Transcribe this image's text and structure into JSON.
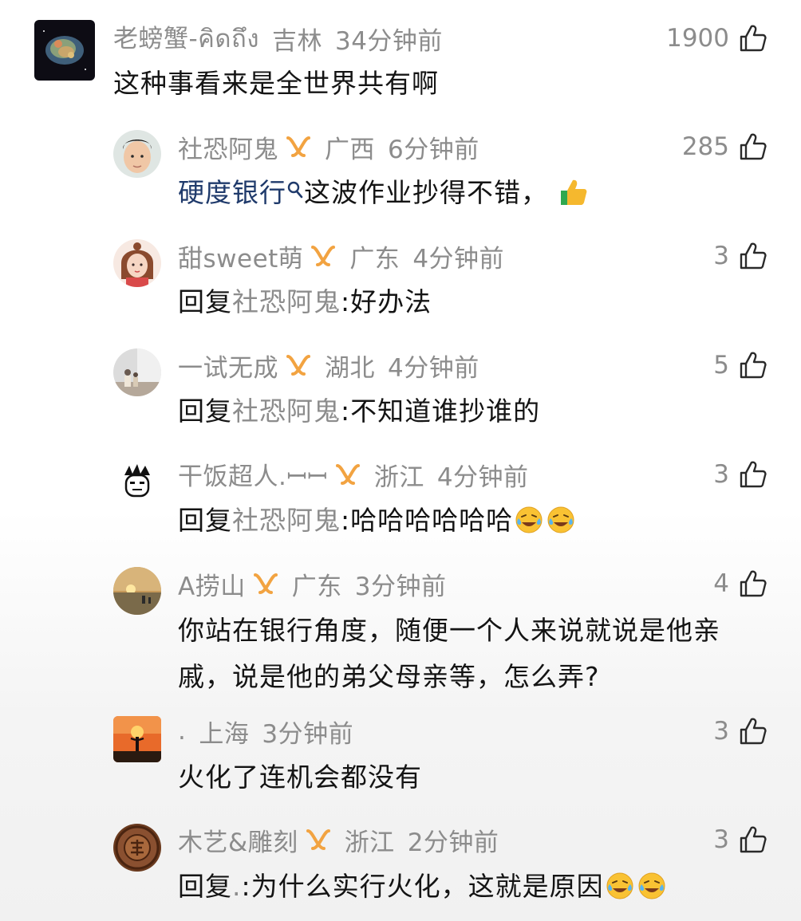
{
  "comments": [
    {
      "username": "老螃蟹-คิดถึง",
      "location": "吉林",
      "time": "34分钟前",
      "likes": "1900",
      "text": "这种事看来是全世界共有啊",
      "avatar_icon": "nebula-avatar"
    },
    {
      "username": "社恐阿鬼",
      "location": "广西",
      "time": "6分钟前",
      "likes": "285",
      "link_text": "硬度银行",
      "text": "这波作业抄得不错，",
      "emoji": "thumbs-up-emoji",
      "avatar_icon": "young-man-avatar"
    },
    {
      "username": "甜sweet萌",
      "location": "广东",
      "time": "4分钟前",
      "likes": "3",
      "reply_prefix": "回复",
      "reply_target": "社恐阿鬼",
      "text": ":好办法",
      "avatar_icon": "cartoon-girl-avatar"
    },
    {
      "username": "一试无成",
      "location": "湖北",
      "time": "4分钟前",
      "likes": "5",
      "reply_prefix": "回复",
      "reply_target": "社恐阿鬼",
      "text": ":不知道谁抄谁的",
      "avatar_icon": "street-photo-avatar"
    },
    {
      "username": "干饭超人.ꟷꟷ",
      "location": "浙江",
      "time": "4分钟前",
      "likes": "3",
      "reply_prefix": "回复",
      "reply_target": "社恐阿鬼",
      "text": ":哈哈哈哈哈哈",
      "emoji": "laugh-cry-emoji",
      "avatar_icon": "cartoon-face-avatar"
    },
    {
      "username": "A捞山",
      "location": "广东",
      "time": "3分钟前",
      "likes": "4",
      "text_line1": "你站在银行角度，随便一个人来说就说是他亲",
      "text_line2": "戚，说是他的弟父母亲等，怎么弄?",
      "avatar_icon": "sunset-avatar"
    },
    {
      "username": ".",
      "location": "上海",
      "time": "3分钟前",
      "likes": "3",
      "text": "火化了连机会都没有",
      "avatar_icon": "orange-sunset-avatar"
    },
    {
      "username": "木艺&雕刻",
      "location": "浙江",
      "time": "2分钟前",
      "likes": "3",
      "reply_prefix": "回复",
      "reply_target": ".",
      "text": ":为什么实行火化，这就是原因",
      "emoji": "laugh-cry-emoji",
      "avatar_icon": "wood-carving-avatar"
    }
  ],
  "icons": {
    "like": "thumbs-up-outline-icon",
    "badge": "gold-ribbon-badge-icon",
    "link_search": "search-icon"
  },
  "colors": {
    "meta_text": "#8c8c8c",
    "body_text": "#141414",
    "link": "#1f3a6b",
    "badge": "#f2a341"
  }
}
